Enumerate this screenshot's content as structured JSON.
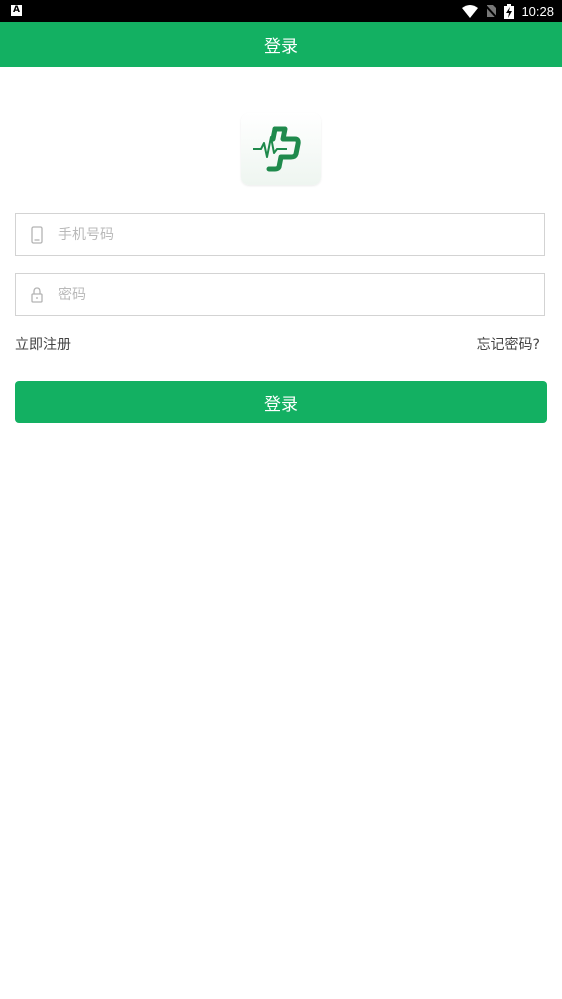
{
  "status_bar": {
    "left_icon_letter": "A",
    "time": "10:28",
    "icons": [
      "wifi-icon",
      "no-sim-icon",
      "battery-charging-icon"
    ]
  },
  "app_bar": {
    "title": "登录"
  },
  "logo": {
    "icon": "medical-cross-heartbeat-logo"
  },
  "form": {
    "phone": {
      "placeholder": "手机号码",
      "value": "",
      "icon": "phone-icon"
    },
    "password": {
      "placeholder": "密码",
      "value": "",
      "icon": "lock-icon"
    }
  },
  "links": {
    "register": "立即注册",
    "forgot_password": "忘记密码?"
  },
  "login_button": {
    "label": "登录"
  },
  "colors": {
    "primary": "#13b062",
    "status_bar": "#000000",
    "input_border": "#d3d3d3",
    "placeholder": "#b9b9b9",
    "link_text": "#444444"
  }
}
